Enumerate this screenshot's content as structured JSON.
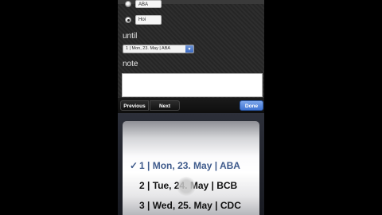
{
  "form": {
    "option_a": {
      "value": "ABA",
      "selected": false
    },
    "option_b": {
      "value": "Hoi",
      "selected": true
    },
    "until_label": "until",
    "until_value": "1 | Mon, 23. May | ABA",
    "note_label": "note",
    "note_value": ""
  },
  "toolbar": {
    "previous": "Previous",
    "next": "Next",
    "done": "Done"
  },
  "picker": {
    "rows": [
      {
        "check": "✓",
        "text": "1 | Mon, 23. May | ABA",
        "selected": true
      },
      {
        "check": "",
        "text": "2 | Tue, 24. May | BCB",
        "selected": false
      },
      {
        "check": "",
        "text": "3 | Wed, 25. May | CDC",
        "selected": false
      }
    ]
  },
  "colors": {
    "accent_blue": "#3f74d3",
    "selected_row_text": "#3f5b8c"
  }
}
